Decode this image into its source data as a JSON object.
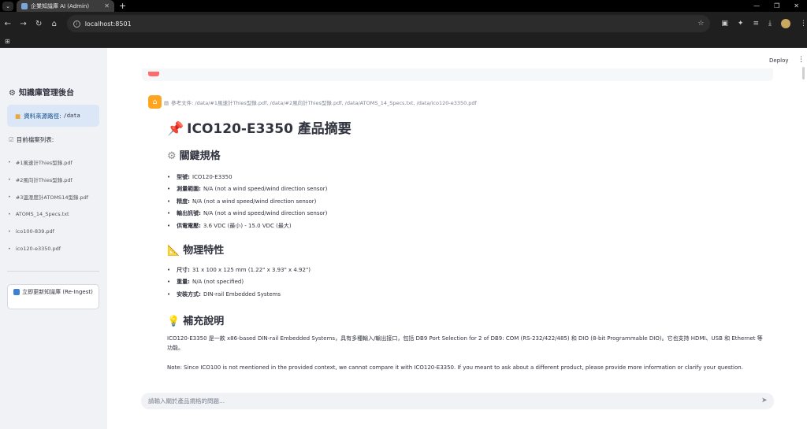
{
  "browser": {
    "tab_title": "企業知識庫 AI (Admin)",
    "url": "localhost:8501"
  },
  "sidebar": {
    "title": "知識庫管理後台",
    "title_icon": "gear-emoji",
    "info_label": "資料來源路徑:",
    "info_path": "/data",
    "files_header": "目前檔案列表:",
    "files": [
      "#1風速計Thies型錄.pdf",
      "#2風向計Thies型錄.pdf",
      "#3溫溼度計ATOMS14型錄.pdf",
      "ATOMS_14_Specs.txt",
      "ico100-839.pdf",
      "ico120-e3350.pdf"
    ],
    "reingest_label": "立即更新知識庫 (Re-Ingest)"
  },
  "header": {
    "deploy_label": "Deploy"
  },
  "message": {
    "refs": "參考文件: /data/#1風速計Thies型錄.pdf, /data/#2風向計Thies型錄.pdf, /data/ATOMS_14_Specs.txt, /data/ico120-e3350.pdf",
    "title": "ICO120-E3350 產品摘要",
    "section_specs": "關鍵規格",
    "specs": [
      {
        "k": "型號:",
        "v": "ICO120-E3350"
      },
      {
        "k": "測量範圍:",
        "v": "N/A (not a wind speed/wind direction sensor)"
      },
      {
        "k": "精度:",
        "v": "N/A (not a wind speed/wind direction sensor)"
      },
      {
        "k": "輸出訊號:",
        "v": "N/A (not a wind speed/wind direction sensor)"
      },
      {
        "k": "供電電壓:",
        "v": "3.6 VDC (最小) - 15.0 VDC (最大)"
      }
    ],
    "section_physical": "物理特性",
    "physical": [
      {
        "k": "尺寸:",
        "v": "31 x 100 x 125 mm (1.22\" x 3.93\" x 4.92\")"
      },
      {
        "k": "重量:",
        "v": "N/A (not specified)"
      },
      {
        "k": "安裝方式:",
        "v": "DIN-rail Embedded Systems"
      }
    ],
    "section_notes": "補充說明",
    "note_1": "ICO120-E3350 是一款 x86-based DIN-rail Embedded Systems，具有多種輸入/輸出接口，包括 DB9 Port Selection for 2 of DB9: COM (RS-232/422/485) 和 DIO (8-bit Programmable DIO)。它也支持 HDMI、USB 和 Ethernet 等功能。",
    "note_2": "Note: Since ICO100 is not mentioned in the provided context, we cannot compare it with ICO120-E3350. If you meant to ask about a different product, please provide more information or clarify your question."
  },
  "chat": {
    "placeholder": "請輸入關於產品規格的問題..."
  }
}
